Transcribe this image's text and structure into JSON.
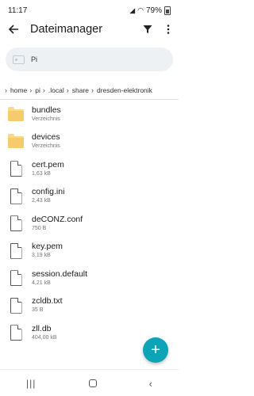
{
  "status": {
    "time": "11:17",
    "battery": "79%",
    "wifi_icon": "wifi-icon",
    "signal_icon": "signal-icon"
  },
  "app": {
    "title": "Dateimanager",
    "back_icon": "arrow-back-icon",
    "filter_icon": "filter-icon",
    "overflow_icon": "more-vert-icon"
  },
  "location": {
    "label": "Pi",
    "icon": "device-icon"
  },
  "breadcrumb": [
    "home",
    "pi",
    ".local",
    "share",
    "dresden-elektronik"
  ],
  "files": [
    {
      "name": "bundles",
      "meta": "Verzeichnis",
      "type": "folder"
    },
    {
      "name": "devices",
      "meta": "Verzeichnis",
      "type": "folder"
    },
    {
      "name": "cert.pem",
      "meta": "1,63 kB",
      "type": "file"
    },
    {
      "name": "config.ini",
      "meta": "2,43 kB",
      "type": "file"
    },
    {
      "name": "deCONZ.conf",
      "meta": "750 B",
      "type": "file"
    },
    {
      "name": "key.pem",
      "meta": "3,19 kB",
      "type": "file"
    },
    {
      "name": "session.default",
      "meta": "4,21 kB",
      "type": "file"
    },
    {
      "name": "zcldb.txt",
      "meta": "35 B",
      "type": "file"
    },
    {
      "name": "zll.db",
      "meta": "404,00 kB",
      "type": "file"
    }
  ],
  "fab": {
    "label": "+"
  },
  "colors": {
    "accent": "#0ea4b8",
    "folder": "#f5cb6b",
    "location_bg": "#eef1f4"
  }
}
